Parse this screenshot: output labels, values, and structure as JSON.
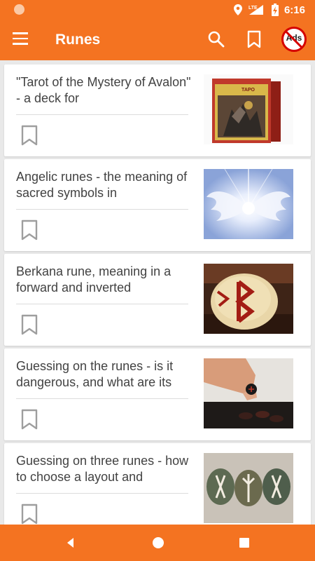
{
  "status_bar": {
    "time": "6:16",
    "network": "LTE"
  },
  "app_bar": {
    "title": "Runes",
    "ads_badge": "Ads"
  },
  "articles": [
    {
      "title": "\"Tarot of the Mystery of Avalon\" - a deck for",
      "thumbnail": "tarot-deck-box-image",
      "thumb_label": "ТАРО"
    },
    {
      "title": "Angelic runes - the meaning of sacred symbols in",
      "thumbnail": "angel-wings-light-image"
    },
    {
      "title": "Berkana rune, meaning in a forward and inverted",
      "thumbnail": "berkana-rune-stone-image"
    },
    {
      "title": "Guessing on the runes - is it dangerous, and what are its",
      "thumbnail": "hand-picking-rune-image"
    },
    {
      "title": "Guessing on three runes - how to choose a layout and",
      "thumbnail": "three-rune-stones-image"
    }
  ],
  "colors": {
    "accent": "#f47321",
    "card_bg": "#ffffff",
    "page_bg": "#e9e9e9",
    "title_text": "#424242",
    "icon_gray": "#9e9e9e"
  }
}
